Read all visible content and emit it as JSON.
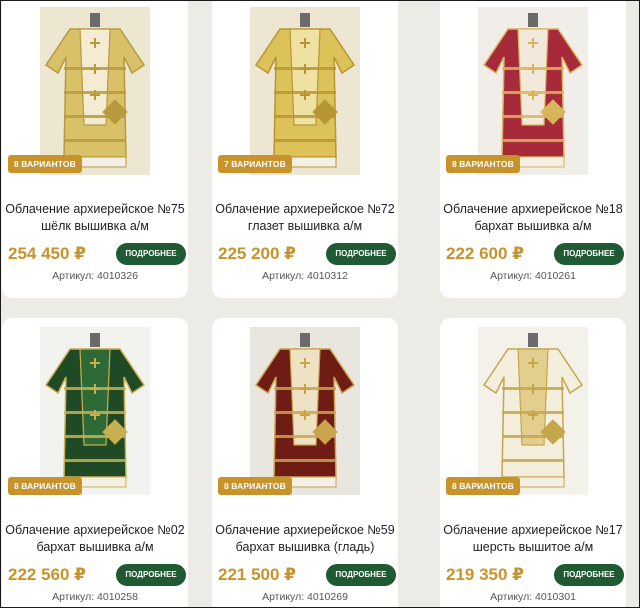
{
  "products": [
    {
      "badge": "8 ВАРИАНТОВ",
      "title_line1": "Облачение архиерейское №75",
      "title_line2": "шёлк вышивка а/м",
      "price": "254 450 ₽",
      "button": "ПОДРОБНЕЕ",
      "article": "Артикул: 4010326",
      "robe_colors": {
        "bg": "#ede6d0",
        "main": "#d9c16a",
        "trim": "#b89a3c",
        "accent": "#f3ecd2"
      }
    },
    {
      "badge": "7 ВАРИАНТОВ",
      "title_line1": "Облачение архиерейское №72",
      "title_line2": "глазет вышивка а/м",
      "price": "225 200 ₽",
      "button": "ПОДРОБНЕЕ",
      "article": "Артикул: 4010312",
      "robe_colors": {
        "bg": "#ece6d3",
        "main": "#dcc259",
        "trim": "#b89533",
        "accent": "#efe1a1"
      }
    },
    {
      "badge": "8 ВАРИАНТОВ",
      "title_line1": "Облачение архиерейское №18",
      "title_line2": "бархат вышивка а/м",
      "price": "222 600 ₽",
      "button": "ПОДРОБНЕЕ",
      "article": "Артикул: 4010261",
      "robe_colors": {
        "bg": "#f1eeea",
        "main": "#a62a3a",
        "trim": "#d8b45a",
        "accent": "#f2e8dc"
      }
    },
    {
      "badge": "8 ВАРИАНТОВ",
      "title_line1": "Облачение архиерейское №02",
      "title_line2": "бархат вышивка а/м",
      "price": "222 560 ₽",
      "button": "ПОДРОБНЕЕ",
      "article": "Артикул: 4010258",
      "robe_colors": {
        "bg": "#f2f2ee",
        "main": "#1f4a25",
        "trim": "#c8b050",
        "accent": "#2e6a36"
      }
    },
    {
      "badge": "8 ВАРИАНТОВ",
      "title_line1": "Облачение архиерейское №59",
      "title_line2": "бархат вышивка (гладь)",
      "price": "221 500 ₽",
      "button": "ПОДРОБНЕЕ",
      "article": "Артикул: 4010269",
      "robe_colors": {
        "bg": "#e9e5df",
        "main": "#6e1c14",
        "trim": "#c9a44c",
        "accent": "#efe2c4"
      }
    },
    {
      "badge": "8 ВАРИАНТОВ",
      "title_line1": "Облачение архиерейское №17",
      "title_line2": "шерсть вышитое а/м",
      "price": "219 350 ₽",
      "button": "ПОДРОБНЕЕ",
      "article": "Артикул: 4010301",
      "robe_colors": {
        "bg": "#f3f1ea",
        "main": "#f4efdc",
        "trim": "#c6a64c",
        "accent": "#e2cf8e"
      }
    }
  ]
}
